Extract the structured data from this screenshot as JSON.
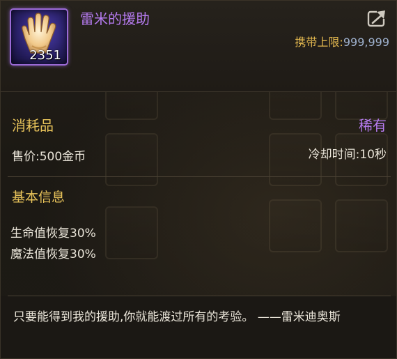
{
  "item": {
    "name": "雷米的援助",
    "count": "2351",
    "icon": "glove-icon"
  },
  "header": {
    "carry_limit_label": "携带上限:",
    "carry_limit_value": "999,999",
    "export_icon": "share-export-icon"
  },
  "details": {
    "type": "消耗品",
    "rarity": "稀有",
    "price": "售价:500金币",
    "cooldown": "冷却时间:10秒"
  },
  "basic_info": {
    "title": "基本信息",
    "stats": [
      "生命值恢复30%",
      "魔法值恢复30%"
    ]
  },
  "description": "只要能得到我的援助,你就能渡过所有的考验。 ——雷米迪奥斯",
  "colors": {
    "rarity_purple": "#b67bf0",
    "label_gold": "#e8c35a",
    "value_blue": "#9fb2cf",
    "text": "#e9e4d8",
    "background": "#1d1a15"
  }
}
